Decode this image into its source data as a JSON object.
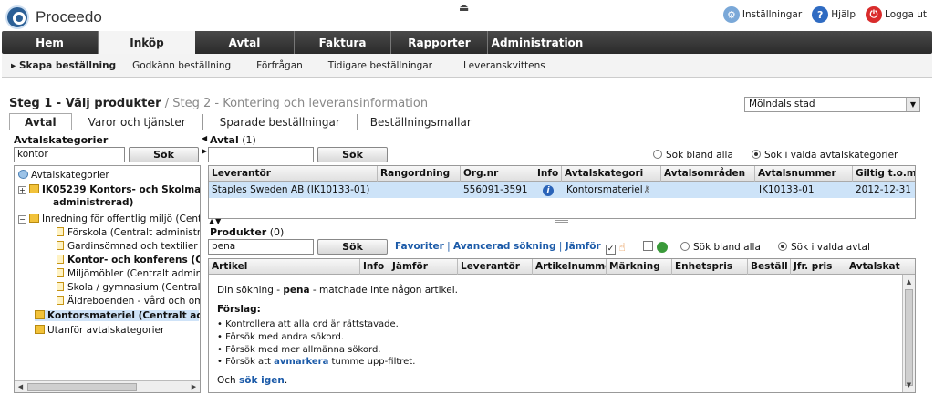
{
  "app": {
    "name": "Proceedo"
  },
  "toplinks": {
    "settings": "Inställningar",
    "help": "Hjälp",
    "logout": "Logga ut"
  },
  "nav": {
    "items": [
      "Hem",
      "Inköp",
      "Avtal",
      "Faktura",
      "Rapporter",
      "Administration"
    ],
    "active": "Inköp"
  },
  "subnav": {
    "items": [
      "Skapa beställning",
      "Godkänn beställning",
      "Förfrågan",
      "Tidigare beställningar",
      "Leveranskvittens"
    ]
  },
  "steps": {
    "step1": "Steg 1 - Välj produkter",
    "sep": " / ",
    "step2": "Steg 2 - Kontering och leveransinformation"
  },
  "org_select": {
    "value": "Mölndals stad"
  },
  "tabs": [
    "Avtal",
    "Varor och tjänster",
    "Sparade beställningar",
    "Beställningsmallar"
  ],
  "categories": {
    "label": "Avtalskategorier",
    "search_value": "kontor",
    "search_button": "Sök",
    "tree": {
      "root": "Avtalskategorier",
      "n1a": "IK05239 Kontors- och Skolma",
      "n1b": "administrerad)",
      "n2": "Inredning för offentlig miljö (Centra",
      "c1": "Förskola (Centralt administrera",
      "c2": "Gardinsömnad och textilier (Ce",
      "c3": "Kontor- och konferens (Ce",
      "c4": "Miljömöbler (Centralt administr",
      "c5": "Skola / gymnasium (Centralt ad",
      "c6": "Äldreboenden - vård och omsc",
      "n3": "Kontorsmateriel (Centralt adm",
      "n4": "Utanför avtalskategorier"
    }
  },
  "agreements": {
    "label": "Avtal",
    "count": "(1)",
    "search_value": "",
    "search_button": "Sök",
    "radio_all": "Sök bland alla",
    "radio_selected": "Sök i valda avtalskategorier",
    "columns": [
      "Leverantör",
      "Rangordning",
      "Org.nr",
      "Info",
      "Avtalskategori",
      "Avtalsområden",
      "Avtalsnummer",
      "Giltig t.o.m."
    ],
    "row": {
      "supplier": "Staples Sweden AB (IK10133-01)",
      "rank": "",
      "orgnr": "556091-3591",
      "info": "i",
      "category": "Kontorsmateriel",
      "areas": "",
      "number": "IK10133-01",
      "valid": "2012-12-31"
    }
  },
  "products": {
    "label": "Produkter",
    "count": "(0)",
    "search_value": "pena",
    "search_button": "Sök",
    "favorites": "Favoriter",
    "advanced": "Avancerad sökning",
    "compare": "Jämför",
    "radio_all": "Sök bland alla",
    "radio_selected": "Sök i valda avtal",
    "columns": [
      "Artikel",
      "Info",
      "Jämför",
      "Leverantör",
      "Artikelnumme",
      "Märkning",
      "Enhetspris",
      "Beställ",
      "Jfr. pris",
      "Avtalskat"
    ],
    "msg_pre": "Din sökning - ",
    "msg_term": "pena",
    "msg_post": " - matchade inte någon artikel.",
    "suggest_title": "Förslag:",
    "s1": "Kontrollera att alla ord är rättstavade.",
    "s2": "Försök med andra sökord.",
    "s3": "Försök med mer allmänna sökord.",
    "s4_pre": "Försök att ",
    "s4_link": "avmarkera",
    "s4_post": " tumme upp-filtret.",
    "again_pre": "Och ",
    "again_link": "sök igen",
    "again_post": "."
  }
}
